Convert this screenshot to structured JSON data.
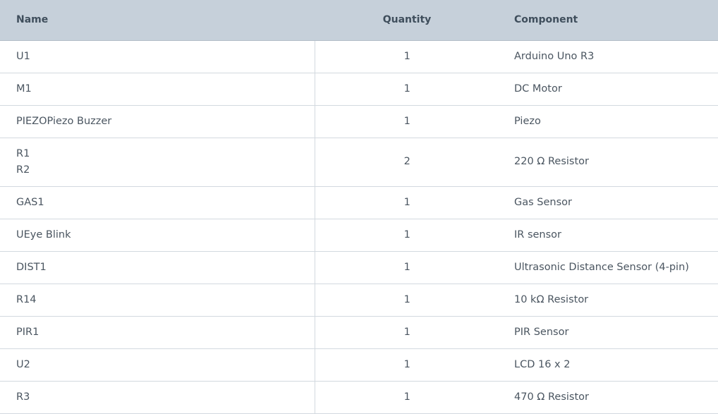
{
  "table": {
    "headers": {
      "name": "Name",
      "quantity": "Quantity",
      "component": "Component"
    },
    "rows": [
      {
        "names": [
          "U1"
        ],
        "quantity": "1",
        "component": "Arduino Uno R3"
      },
      {
        "names": [
          "M1"
        ],
        "quantity": "1",
        "component": "DC Motor"
      },
      {
        "names": [
          "PIEZOPiezo Buzzer"
        ],
        "quantity": "1",
        "component": "Piezo"
      },
      {
        "names": [
          "R1",
          "R2"
        ],
        "quantity": "2",
        "component": "220 Ω Resistor"
      },
      {
        "names": [
          "GAS1"
        ],
        "quantity": "1",
        "component": "Gas Sensor"
      },
      {
        "names": [
          "UEye Blink"
        ],
        "quantity": "1",
        "component": "IR sensor"
      },
      {
        "names": [
          "DIST1"
        ],
        "quantity": "1",
        "component": "Ultrasonic Distance Sensor (4-pin)"
      },
      {
        "names": [
          "R14"
        ],
        "quantity": "1",
        "component": "10 kΩ Resistor"
      },
      {
        "names": [
          "PIR1"
        ],
        "quantity": "1",
        "component": "PIR Sensor"
      },
      {
        "names": [
          "U2"
        ],
        "quantity": "1",
        "component": "LCD 16 x 2"
      },
      {
        "names": [
          "R3"
        ],
        "quantity": "1",
        "component": "470 Ω Resistor"
      }
    ]
  }
}
